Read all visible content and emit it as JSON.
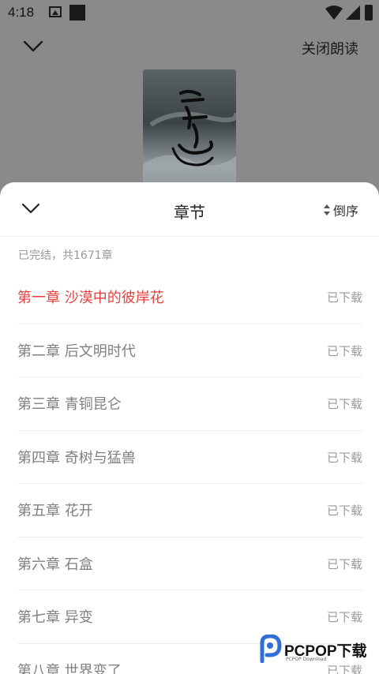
{
  "status_bar": {
    "time": "4:18"
  },
  "player": {
    "close_reading_label": "关闭朗读"
  },
  "chapters_sheet": {
    "title": "章节",
    "sort_label": "倒序",
    "summary": "已完结，共1671章",
    "chapters": [
      {
        "title": "第一章 沙漠中的彼岸花",
        "status": "已下载",
        "active": true
      },
      {
        "title": "第二章 后文明时代",
        "status": "已下载",
        "active": false
      },
      {
        "title": "第三章 青铜昆仑",
        "status": "已下载",
        "active": false
      },
      {
        "title": "第四章 奇树与猛兽",
        "status": "已下载",
        "active": false
      },
      {
        "title": "第五章 花开",
        "status": "已下载",
        "active": false
      },
      {
        "title": "第六章 石盒",
        "status": "已下载",
        "active": false
      },
      {
        "title": "第七章 异变",
        "status": "已下载",
        "active": false
      },
      {
        "title": "第八章 世界变了",
        "status": "已下载",
        "active": false
      }
    ],
    "colors": {
      "active_chapter": "#e8403f",
      "inactive_chapter": "#808080",
      "status_text": "#999999"
    }
  },
  "watermark": {
    "brand": "PCPOP下载",
    "subtext": "PCPOP Download"
  }
}
